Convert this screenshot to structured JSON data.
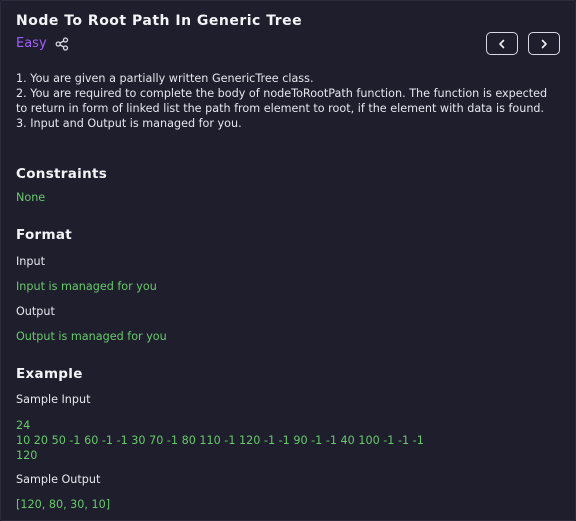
{
  "problem": {
    "title": "Node To Root Path In Generic Tree",
    "difficulty": "Easy",
    "description": [
      "1. You are given a partially written GenericTree class.",
      "2. You are required to complete the body of nodeToRootPath function. The function is expected to return in form of linked list the path from element to root, if the element with data is found.",
      "3. Input and Output is managed for you."
    ]
  },
  "constraints": {
    "heading": "Constraints",
    "value": "None"
  },
  "format": {
    "heading": "Format",
    "input_label": "Input",
    "input_value": "Input is managed for you",
    "output_label": "Output",
    "output_value": "Output is managed for you"
  },
  "example": {
    "heading": "Example",
    "sample_input_label": "Sample Input",
    "sample_input_lines": [
      "24",
      "10 20 50 -1 60 -1 -1 30 70 -1 80 110 -1 120 -1 -1 90 -1 -1 40 100 -1 -1 -1",
      "120"
    ],
    "sample_output_label": "Sample Output",
    "sample_output": "[120, 80, 30, 10]"
  },
  "icons": {
    "share": "share-icon",
    "prev": "chevron-left-icon",
    "next": "chevron-right-icon"
  },
  "colors": {
    "background": "#1e1e2c",
    "accent_difficulty": "#a35cff",
    "green_text": "#67c96b"
  }
}
